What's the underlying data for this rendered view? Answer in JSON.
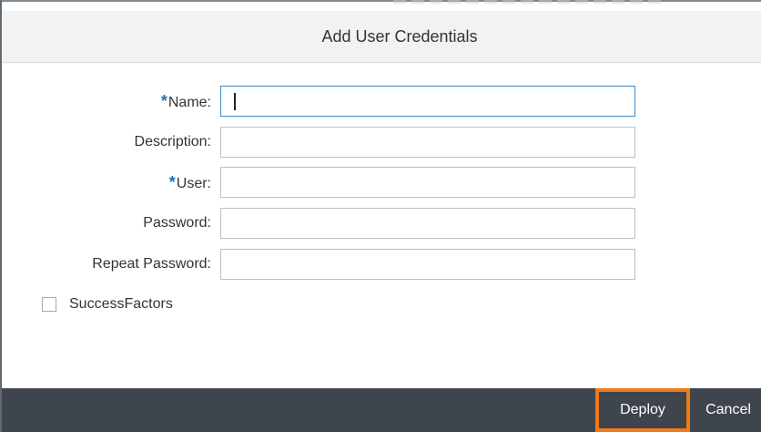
{
  "dialog": {
    "title": "Add User Credentials"
  },
  "form": {
    "fields": [
      {
        "label": "Name:",
        "required": true,
        "value": ""
      },
      {
        "label": "Description:",
        "required": false,
        "value": ""
      },
      {
        "label": "User:",
        "required": true,
        "value": ""
      },
      {
        "label": "Password:",
        "required": false,
        "value": ""
      },
      {
        "label": "Repeat Password:",
        "required": false,
        "value": ""
      }
    ],
    "required_marker": "*",
    "checkbox": {
      "label": "SuccessFactors",
      "checked": false
    }
  },
  "footer": {
    "deploy_label": "Deploy",
    "cancel_label": "Cancel"
  },
  "colors": {
    "footer_bg": "#3e454c",
    "highlight": "#f07a1a",
    "required_marker": "#1f6fb5",
    "focus_border": "#3f8bc9"
  }
}
